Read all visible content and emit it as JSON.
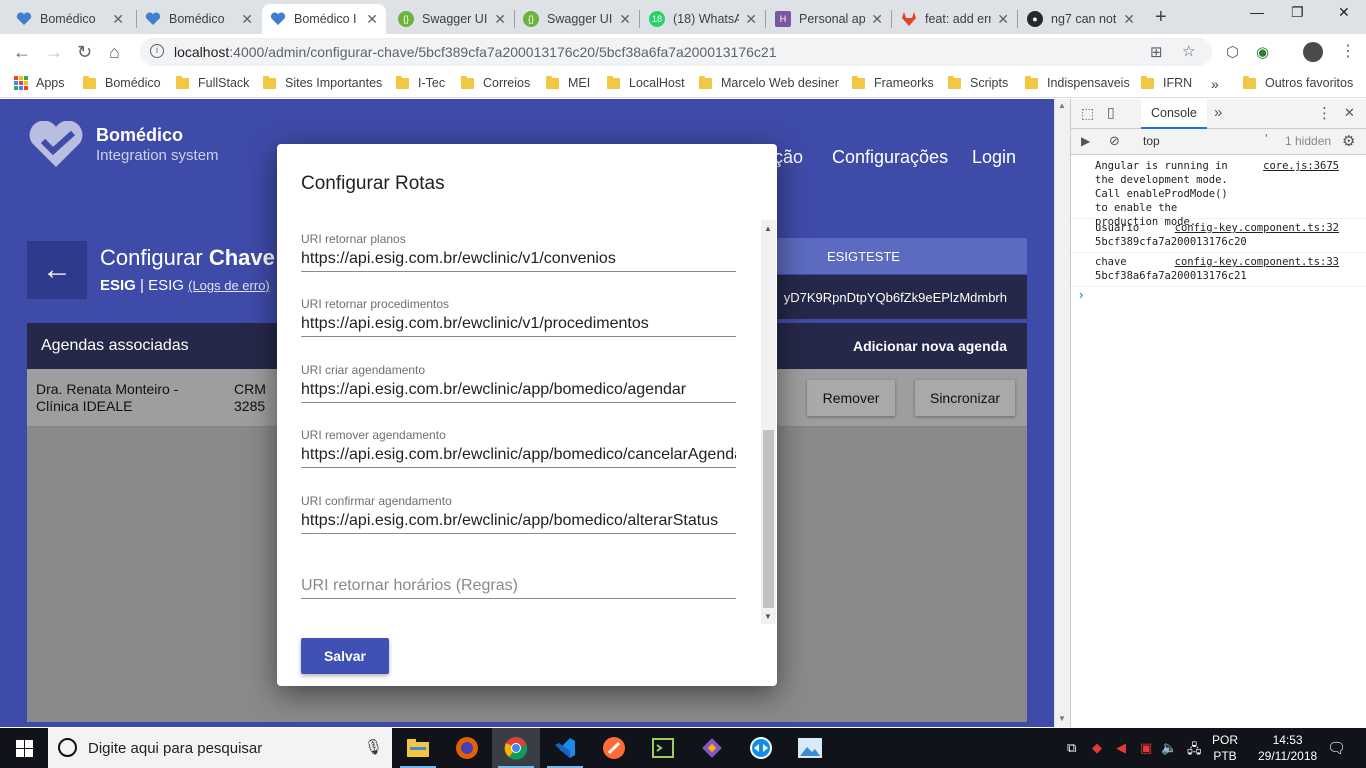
{
  "browser": {
    "tabs": [
      {
        "title": "Bomédico",
        "favicon": "heart-favicon",
        "color": "#3f7fd0",
        "active": false
      },
      {
        "title": "Bomédico",
        "favicon": "heart-favicon",
        "color": "#3f7fd0",
        "active": false
      },
      {
        "title": "Bomédico I",
        "favicon": "heart-favicon",
        "color": "#3f7fd0",
        "active": true
      },
      {
        "title": "Swagger UI",
        "favicon": "swagger-favicon",
        "color": "#6cb33e",
        "active": false
      },
      {
        "title": "Swagger UI",
        "favicon": "swagger-favicon",
        "color": "#6cb33e",
        "active": false
      },
      {
        "title": "(18) WhatsA",
        "favicon": "whatsapp-favicon",
        "color": "#25d366",
        "active": false
      },
      {
        "title": "Personal ap",
        "favicon": "heroku-favicon",
        "color": "#79589f",
        "active": false
      },
      {
        "title": "feat: add err",
        "favicon": "gitlab-favicon",
        "color": "#e24329",
        "active": false
      },
      {
        "title": "ng7 can not",
        "favicon": "github-favicon",
        "color": "#24292e",
        "active": false
      }
    ],
    "url_host": "localhost",
    "url_path": ":4000/admin/configurar-chave/5bcf389cfa7a200013176c20/5bcf38a6fa7a200013176c21",
    "bookmarks": [
      "Apps",
      "Bomédico",
      "FullStack",
      "Sites Importantes",
      "I-Tec",
      "Correios",
      "MEI",
      "LocalHost",
      "Marcelo Web desiner",
      "Frameorks",
      "Scripts",
      "Indispensaveis",
      "IFRN"
    ],
    "bookmarks_more": "»",
    "other_favorites": "Outros favoritos"
  },
  "app": {
    "brand_name": "Bomédico",
    "brand_sub": "Integration system",
    "nav_partial": "ção",
    "nav_config": "Configurações",
    "nav_login": "Login",
    "page_title_a": "Configurar ",
    "page_title_b": "Chave",
    "page_sub_a": "ESIG",
    "page_sub_sep": " | ",
    "page_sub_b": "ESIG ",
    "page_sub_link": "(Logs de erro)",
    "env_badge": "ESIGTESTE",
    "key_value": "yD7K9RpnDtpYQb6fZk9eEPlzMdmbrh",
    "agendas_title": "Agendas associadas",
    "add_agenda": "Adicionar nova agenda",
    "agenda_row": {
      "doctor": "Dra. Renata Monteiro - Clínica IDEALE",
      "crm": "CRM 3285",
      "remove": "Remover",
      "sync": "Sincronizar"
    }
  },
  "modal": {
    "title": "Configurar Rotas",
    "fields": [
      {
        "label": "URI retornar planos",
        "value": "https://api.esig.com.br/ewclinic/v1/convenios"
      },
      {
        "label": "URI retornar procedimentos",
        "value": "https://api.esig.com.br/ewclinic/v1/procedimentos"
      },
      {
        "label": "URI criar agendamento",
        "value": "https://api.esig.com.br/ewclinic/app/bomedico/agendar"
      },
      {
        "label": "URI remover agendamento",
        "value": "https://api.esig.com.br/ewclinic/app/bomedico/cancelarAgendamento"
      },
      {
        "label": "URI confirmar agendamento",
        "value": "https://api.esig.com.br/ewclinic/app/bomedico/alterarStatus"
      }
    ],
    "placeholder_field": "URI retornar horários (Regras)",
    "save": "Salvar"
  },
  "devtools": {
    "tab": "Console",
    "more": "»",
    "context": "top",
    "hidden": "1 hidden",
    "messages": [
      {
        "text": "Angular is running in the development mode. Call enableProdMode() to enable the production mode.",
        "source": "core.js:3675"
      },
      {
        "text": "usuario\n5bcf389cfa7a200013176c20",
        "source": "config-key.component.ts:32"
      },
      {
        "text": "chave\n5bcf38a6fa7a200013176c21",
        "source": "config-key.component.ts:33"
      }
    ],
    "prompt": "›"
  },
  "taskbar": {
    "search": "Digite aqui para pesquisar",
    "lang_top": "POR",
    "lang_bottom": "PTB",
    "time": "14:53",
    "date": "29/11/2018"
  },
  "colors": {
    "app_primary": "#3f4ba8",
    "app_dark": "#26284a",
    "button_primary": "#3f51b5"
  }
}
